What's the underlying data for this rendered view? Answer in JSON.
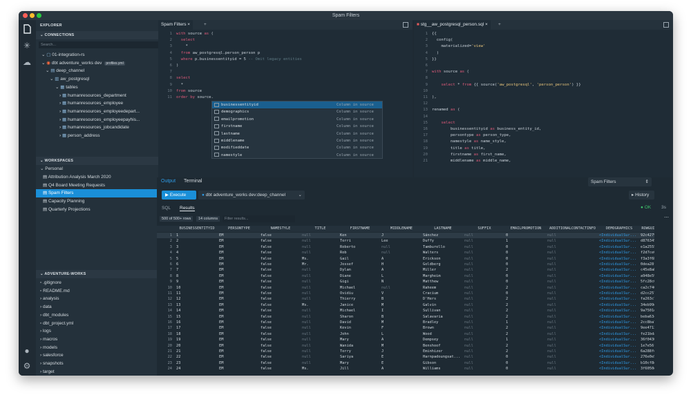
{
  "window": {
    "title": "Spam Filters"
  },
  "explorer": {
    "title": "EXPLORER",
    "connections_header": "CONNECTIONS",
    "search_placeholder": "Search...",
    "conn_rows": [
      {
        "text": "01-integration-rs",
        "badge": "2"
      },
      {
        "text": "dbt adventure_works dev",
        "badge": "7",
        "tag": "profiles.yml"
      },
      {
        "text": "deep_channel",
        "badge": "5"
      },
      {
        "text": "aw_postgresql"
      },
      {
        "text": "tables"
      },
      {
        "text": "humanresources_department"
      },
      {
        "text": "humanresources_employee"
      },
      {
        "text": "humanresources_employeedepart..."
      },
      {
        "text": "humanresources_employeepayhis..."
      },
      {
        "text": "humanresources_jobcandidate"
      },
      {
        "text": "person_address"
      }
    ],
    "workspaces_header": "WORKSPACES",
    "workspace_group": "Personal",
    "workspaces": [
      "Attribution Analysis March 2020",
      "Q4 Board Meeting Requests",
      "Spam Filters",
      "Capacity Planning",
      "Quarterly Projections"
    ],
    "project_header": "ADVENTURE-WORKS",
    "files": [
      ".gitignore",
      "README.md",
      "analysis",
      "data",
      "dbt_modules",
      "dbt_project.yml",
      "logs",
      "macros",
      "models",
      "salesforce",
      "snapshots",
      "target",
      "tests"
    ]
  },
  "editor1": {
    "tab": "Spam Filters",
    "lines": [
      [
        "1",
        "with source as ("
      ],
      [
        "2",
        "  select"
      ],
      [
        "3",
        "    *"
      ],
      [
        "4",
        "  from aw_postgresql.person_person p"
      ],
      [
        "5",
        "  where p.businessentityid = 5 -- Omit legacy entities"
      ],
      [
        "6",
        ")"
      ],
      [
        "7",
        ""
      ],
      [
        "8",
        "select"
      ],
      [
        "9",
        "  *"
      ],
      [
        "10",
        "from source"
      ],
      [
        "11",
        "order by source."
      ]
    ]
  },
  "autocomplete": {
    "items": [
      "businessentityid",
      "demographics",
      "emailpromotion",
      "firstname",
      "lastname",
      "middlename",
      "modifieddate",
      "namestyle"
    ],
    "kind": "Column in source"
  },
  "editor2": {
    "tab": "stg__aw_postgresql_person.sql",
    "lines": [
      [
        "1",
        "{{"
      ],
      [
        "2",
        "  config("
      ],
      [
        "3",
        "    materialized='view'"
      ],
      [
        "4",
        "  )"
      ],
      [
        "5",
        "}}"
      ],
      [
        "6",
        ""
      ],
      [
        "7",
        "with source as ("
      ],
      [
        "8",
        ""
      ],
      [
        "9",
        "    select * from {{ source('aw_postgresql', 'person_person') }}"
      ],
      [
        "10",
        ""
      ],
      [
        "11",
        "),"
      ],
      [
        "12",
        ""
      ],
      [
        "13",
        "renamed as ("
      ],
      [
        "14",
        ""
      ],
      [
        "15",
        "    select"
      ],
      [
        "16",
        "        businessentityid as business_entity_id,"
      ],
      [
        "17",
        "        persontype as person_type,"
      ],
      [
        "18",
        "        namestyle as name_style,"
      ],
      [
        "19",
        "        title as title,"
      ],
      [
        "20",
        "        firstname as first_name,"
      ],
      [
        "21",
        "        middlename as middle_name,"
      ]
    ]
  },
  "output": {
    "tab_output": "Output",
    "tab_terminal": "Terminal",
    "execute": "Execute",
    "connection": "dbt adventure_works dev:deep_channel",
    "selector": "Spam Filters",
    "history": "History",
    "tab_sql": "SQL",
    "tab_results": "Results",
    "status": "OK",
    "time": "3s",
    "row_count": "500 of 500+ rows",
    "col_count": "14 columns",
    "filter_placeholder": "Filter results..."
  },
  "table": {
    "columns": [
      "BUSINESSENTITYID",
      "PERSONTYPE",
      "NAMESTYLE",
      "TITLE",
      "FIRSTNAME",
      "MIDDLENAME",
      "LASTNAME",
      "SUFFIX",
      "EMAILPROMOTION",
      "ADDITIONALCONTACTINFO",
      "DEMOGRAPHICS",
      "ROWGUID"
    ],
    "rows": [
      [
        "1",
        "EM",
        "false",
        "null",
        "Ken",
        "J",
        "Sánchez",
        "null",
        "0",
        "null",
        "<IndividualSur...",
        "92c4279f-12"
      ],
      [
        "2",
        "EM",
        "false",
        "null",
        "Terri",
        "Lee",
        "Duffy",
        "null",
        "1",
        "null",
        "<IndividualSur...",
        "d8763459-8a"
      ],
      [
        "3",
        "EM",
        "false",
        "null",
        "Roberto",
        "null",
        "Tamburello",
        "null",
        "0",
        "null",
        "<IndividualSur...",
        "e1a2555e-08"
      ],
      [
        "4",
        "EM",
        "false",
        "null",
        "Rob",
        "null",
        "Walters",
        "null",
        "0",
        "null",
        "<IndividualSur...",
        "f2d7ce06-38"
      ],
      [
        "5",
        "EM",
        "false",
        "Ms.",
        "Gail",
        "A",
        "Erickson",
        "null",
        "0",
        "null",
        "<IndividualSur...",
        "f3a3f6b4-ae"
      ],
      [
        "6",
        "EM",
        "false",
        "Mr.",
        "Jossef",
        "H",
        "Goldberg",
        "null",
        "0",
        "null",
        "<IndividualSur...",
        "0dea28fd-ef"
      ],
      [
        "7",
        "EM",
        "false",
        "null",
        "Dylan",
        "A",
        "Miller",
        "null",
        "2",
        "null",
        "<IndividualSur...",
        "c45e8ab8-01"
      ],
      [
        "8",
        "EM",
        "false",
        "null",
        "Diane",
        "L",
        "Margheim",
        "null",
        "0",
        "null",
        "<IndividualSur...",
        "a948e590-4a"
      ],
      [
        "9",
        "EM",
        "false",
        "null",
        "Gigi",
        "N",
        "Matthew",
        "null",
        "0",
        "null",
        "<IndividualSur...",
        "5fc28c0e-6d"
      ],
      [
        "10",
        "EM",
        "false",
        "null",
        "Michael",
        "null",
        "Raheem",
        "null",
        "2",
        "null",
        "<IndividualSur...",
        "ca2c740e-75"
      ],
      [
        "11",
        "EM",
        "false",
        "null",
        "Ovidiu",
        "V",
        "Cracium",
        "null",
        "0",
        "null",
        "<IndividualSur...",
        "d2cc2577-ef"
      ],
      [
        "12",
        "EM",
        "false",
        "null",
        "Thierry",
        "B",
        "D'Hers",
        "null",
        "2",
        "null",
        "<IndividualSur...",
        "fa263c7f-60"
      ],
      [
        "13",
        "EM",
        "false",
        "Ms.",
        "Janice",
        "M",
        "Galvin",
        "null",
        "2",
        "null",
        "<IndividualSur...",
        "34eb99e0-70"
      ],
      [
        "14",
        "EM",
        "false",
        "null",
        "Michael",
        "I",
        "Sullivan",
        "null",
        "2",
        "null",
        "<IndividualSur...",
        "9a7501de-5c"
      ],
      [
        "15",
        "EM",
        "false",
        "null",
        "Sharon",
        "B",
        "Salavaria",
        "null",
        "2",
        "null",
        "<IndividualSur...",
        "beba63cb-13"
      ],
      [
        "16",
        "EM",
        "false",
        "null",
        "David",
        "M",
        "Bradley",
        "null",
        "1",
        "null",
        "<IndividualSur...",
        "2cc8ba72-5d"
      ],
      [
        "17",
        "EM",
        "false",
        "null",
        "Kevin",
        "F",
        "Brown",
        "null",
        "2",
        "null",
        "<IndividualSur...",
        "9ee4713e-b3"
      ],
      [
        "18",
        "EM",
        "false",
        "null",
        "John",
        "L",
        "Wood",
        "null",
        "2",
        "null",
        "<IndividualSur...",
        "fe21bda7-93"
      ],
      [
        "19",
        "EM",
        "false",
        "null",
        "Mary",
        "A",
        "Dempsey",
        "null",
        "1",
        "null",
        "<IndividualSur...",
        "36f04305-67"
      ],
      [
        "20",
        "EM",
        "false",
        "null",
        "Wanida",
        "M",
        "Benshoof",
        "null",
        "2",
        "null",
        "<IndividualSur...",
        "1e7e56f4-a5"
      ],
      [
        "21",
        "EM",
        "false",
        "null",
        "Terry",
        "J",
        "Eminhizer",
        "null",
        "2",
        "null",
        "<IndividualSur...",
        "6a288fe0-49"
      ],
      [
        "22",
        "EM",
        "false",
        "null",
        "Sariya",
        "E",
        "Harnpadoungsat...",
        "null",
        "0",
        "null",
        "<IndividualSur...",
        "276e0e55-8c"
      ],
      [
        "23",
        "EM",
        "false",
        "null",
        "Mary",
        "E",
        "Gibson",
        "null",
        "0",
        "null",
        "<IndividualSur...",
        "b10cf8eb-55"
      ],
      [
        "24",
        "EM",
        "false",
        "Ms.",
        "Jill",
        "A",
        "Williams",
        "null",
        "0",
        "null",
        "<IndividualSur...",
        "3f6050d0-96"
      ]
    ]
  }
}
